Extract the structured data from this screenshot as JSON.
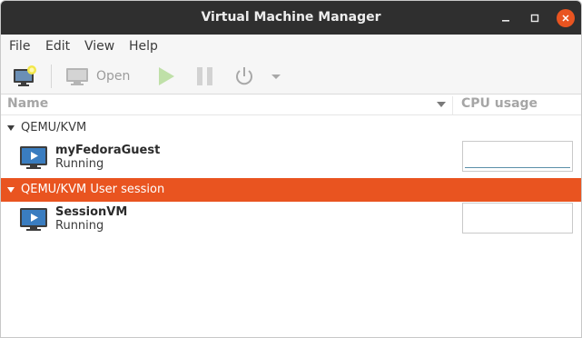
{
  "window": {
    "title": "Virtual Machine Manager"
  },
  "menubar": {
    "items": [
      "File",
      "Edit",
      "View",
      "Help"
    ]
  },
  "toolbar": {
    "open_label": "Open"
  },
  "columns": {
    "name": "Name",
    "cpu": "CPU usage"
  },
  "groups": [
    {
      "label": "QEMU/KVM",
      "vms": [
        {
          "name": "myFedoraGuest",
          "status": "Running",
          "cpu_usage": 0.0
        }
      ]
    },
    {
      "label": "QEMU/KVM User session",
      "selected": true,
      "vms": [
        {
          "name": "SessionVM",
          "status": "Running",
          "cpu_usage": 0.0
        }
      ]
    }
  ],
  "colors": {
    "accent": "#e95420",
    "titlebar": "#2f2f2f",
    "cpu_line": "#5b8fa9"
  }
}
